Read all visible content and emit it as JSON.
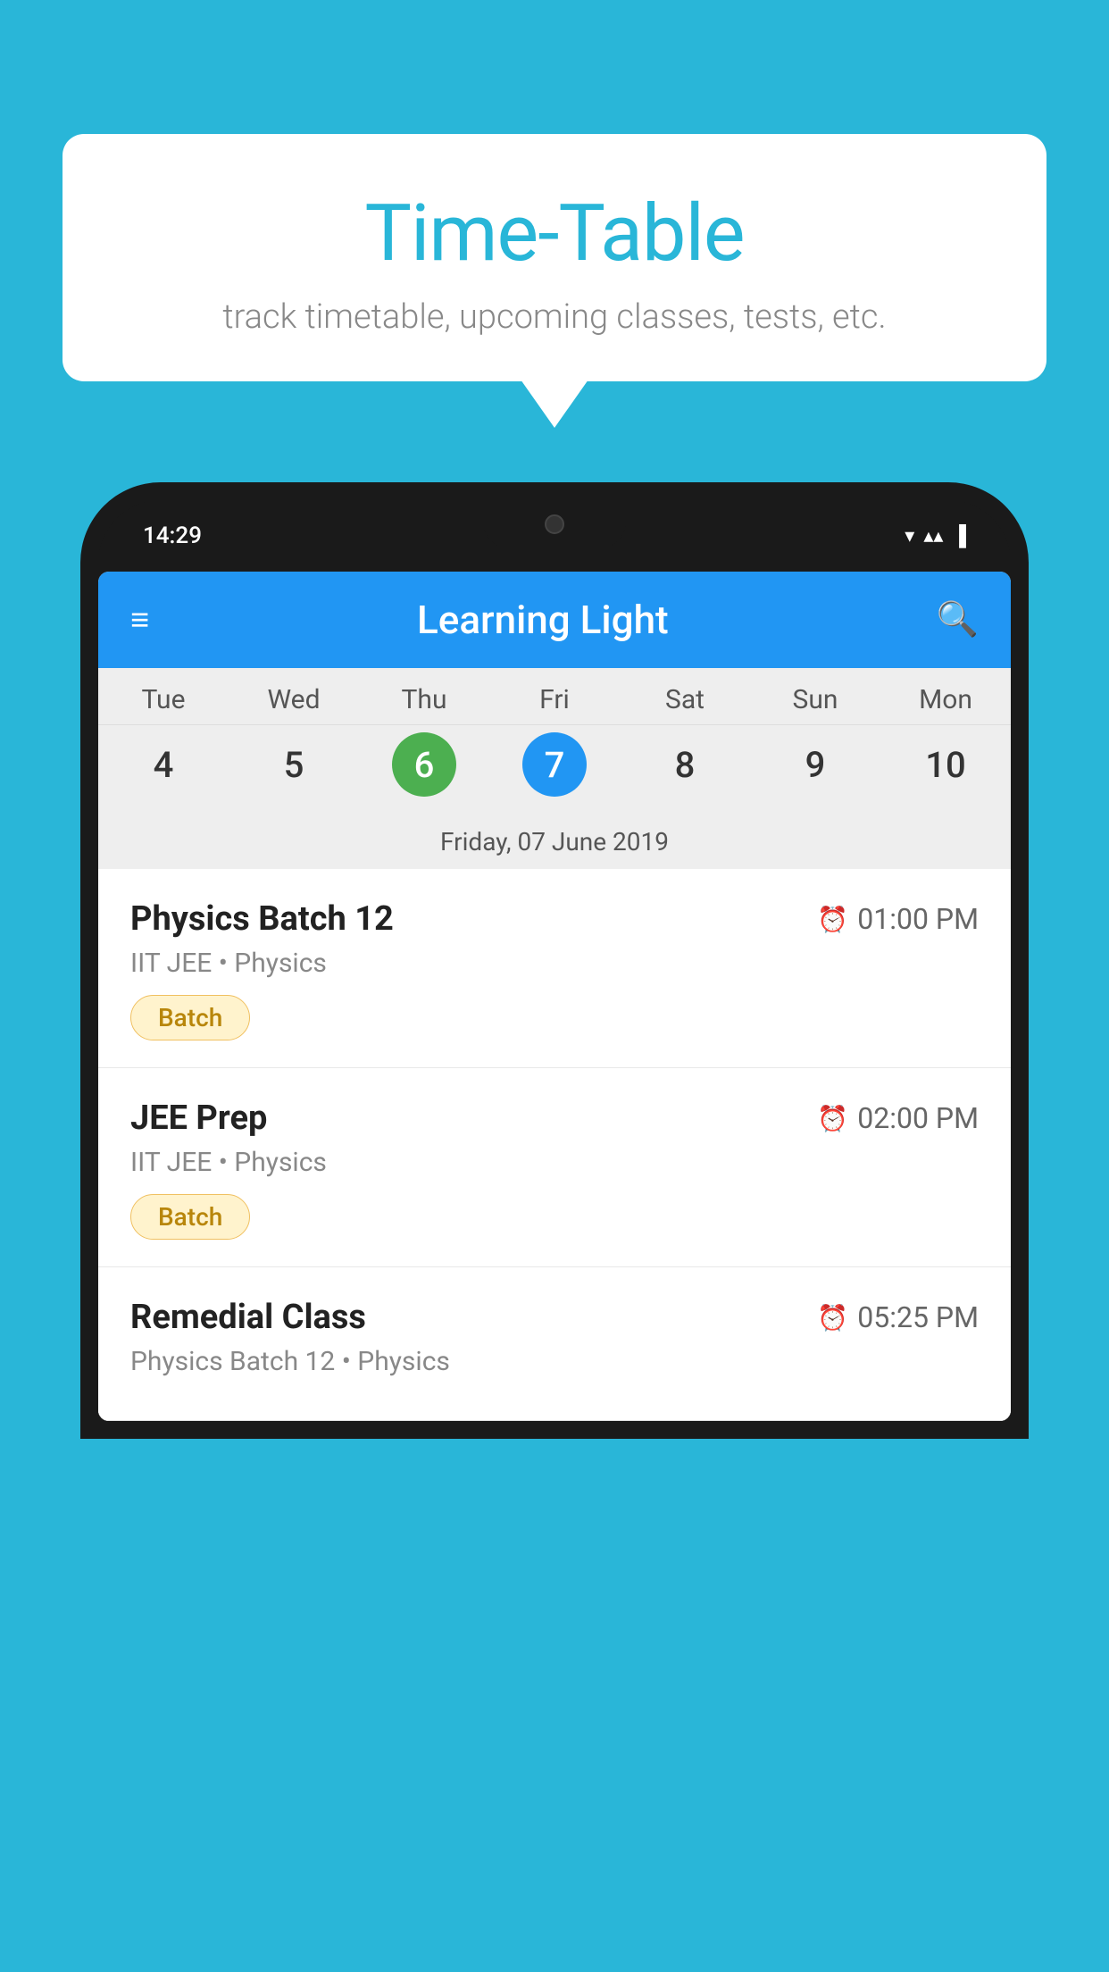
{
  "background_color": "#29b6d8",
  "bubble": {
    "title": "Time-Table",
    "subtitle": "track timetable, upcoming classes, tests, etc."
  },
  "phone": {
    "status_bar": {
      "time": "14:29"
    },
    "app_header": {
      "title": "Learning Light"
    },
    "calendar": {
      "days": [
        {
          "label": "Tue",
          "number": "4"
        },
        {
          "label": "Wed",
          "number": "5"
        },
        {
          "label": "Thu",
          "number": "6",
          "style": "green"
        },
        {
          "label": "Fri",
          "number": "7",
          "style": "blue"
        },
        {
          "label": "Sat",
          "number": "8"
        },
        {
          "label": "Sun",
          "number": "9"
        },
        {
          "label": "Mon",
          "number": "10"
        }
      ],
      "selected_date": "Friday, 07 June 2019"
    },
    "schedule": [
      {
        "title": "Physics Batch 12",
        "time": "01:00 PM",
        "subtitle": "IIT JEE • Physics",
        "tag": "Batch"
      },
      {
        "title": "JEE Prep",
        "time": "02:00 PM",
        "subtitle": "IIT JEE • Physics",
        "tag": "Batch"
      },
      {
        "title": "Remedial Class",
        "time": "05:25 PM",
        "subtitle": "Physics Batch 12 • Physics",
        "tag": ""
      }
    ]
  }
}
